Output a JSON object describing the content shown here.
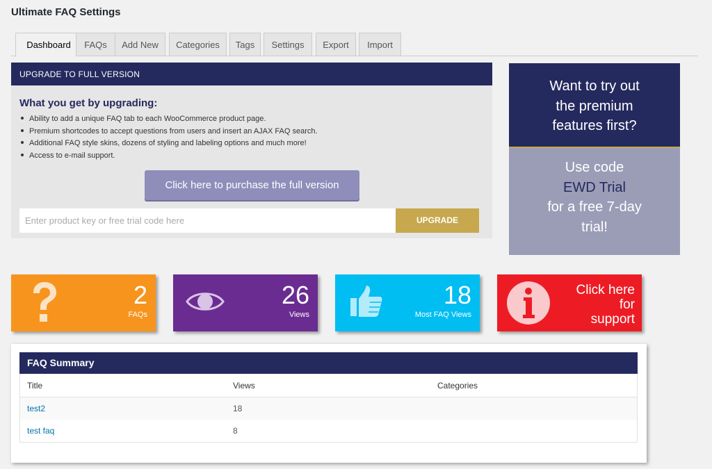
{
  "page": {
    "title": "Ultimate FAQ Settings"
  },
  "tabs": [
    {
      "label": "Dashboard",
      "active": true
    },
    {
      "label": "FAQs"
    },
    {
      "label": "Add New"
    },
    {
      "label": "Categories"
    },
    {
      "label": "Tags"
    },
    {
      "label": "Settings"
    },
    {
      "label": "Export"
    },
    {
      "label": "Import"
    }
  ],
  "upgrade": {
    "heading": "UPGRADE TO FULL VERSION",
    "subheading": "What you get by upgrading:",
    "benefits": [
      "Ability to add a unique FAQ tab to each WooCommerce product page.",
      "Premium shortcodes to accept questions from users and insert an AJAX FAQ search.",
      "Additional FAQ style skins, dozens of styling and labeling options and much more!",
      "Access to e-mail support."
    ],
    "purchase_label": "Click here to purchase the full version",
    "key_placeholder": "Enter product key or free trial code here",
    "key_value": "",
    "upgrade_label": "UPGRADE"
  },
  "trial": {
    "question_lines": [
      "Want to try out",
      "the premium",
      "features first?"
    ],
    "use_code": "Use code",
    "code": "EWD Trial",
    "offer_lines": [
      "for a free 7-day",
      "trial!"
    ]
  },
  "stats": {
    "faqs": {
      "value": "2",
      "label": "FAQs",
      "icon": "question-icon",
      "color": "#f7941e"
    },
    "views": {
      "value": "26",
      "label": "Views",
      "icon": "eye-icon",
      "color": "#6a2c91"
    },
    "most": {
      "value": "18",
      "label": "Most FAQ Views",
      "icon": "thumbs-up-icon",
      "color": "#00bdf2"
    },
    "support": {
      "lines": [
        "Click here",
        "for",
        "support"
      ],
      "icon": "info-icon",
      "color": "#ed1c24"
    }
  },
  "summary": {
    "heading": "FAQ Summary",
    "columns": [
      "Title",
      "Views",
      "Categories"
    ],
    "rows": [
      {
        "title": "test2",
        "views": "18",
        "categories": ""
      },
      {
        "title": "test faq",
        "views": "8",
        "categories": ""
      }
    ]
  },
  "colors": {
    "navy": "#242a5e",
    "gold": "#c7a84e",
    "link": "#0073aa"
  }
}
